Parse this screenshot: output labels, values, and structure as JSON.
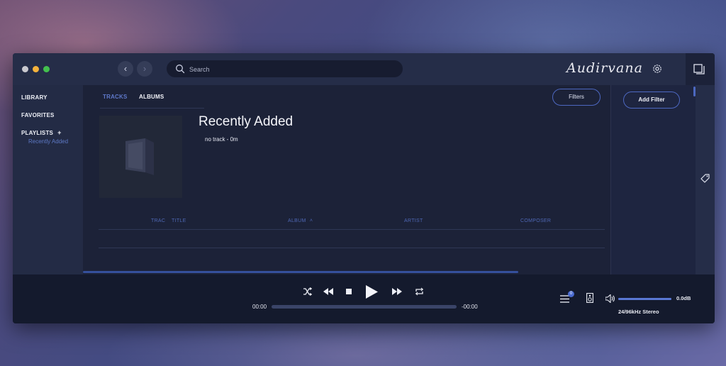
{
  "app": {
    "brand": "Audirvana",
    "search_placeholder": "Search"
  },
  "sidebar": {
    "library": "LIBRARY",
    "favorites": "FAVORITES",
    "playlists": "PLAYLISTS",
    "playlists_add": "+",
    "playlist_items": [
      "Recently Added"
    ]
  },
  "main": {
    "tabs": [
      "TRACKS",
      "ALBUMS"
    ],
    "active_tab": "TRACKS",
    "filters_label": "Filters",
    "playlist_title": "Recently Added",
    "playlist_meta": "no track - 0m",
    "columns": [
      "TRAC",
      "TITLE",
      "ALBUM",
      "ARTIST",
      "COMPOSER"
    ],
    "sort_column": "ALBUM"
  },
  "filter_panel": {
    "add_filter_label": "Add Filter"
  },
  "player": {
    "elapsed": "00:00",
    "remaining": "-00:00",
    "progress": 0,
    "queue_count": "0",
    "volume_db": "0.0dB",
    "volume_level": 1.0,
    "format": "24/96kHz Stereo"
  },
  "colors": {
    "accent": "#5e78c9",
    "window_bg": "#222a44",
    "player_bg": "#141a2d"
  },
  "icons": [
    "back-icon",
    "forward-icon",
    "search-icon",
    "settings-icon",
    "mini-player-icon",
    "album-placeholder-icon",
    "tag-icon",
    "shuffle-icon",
    "previous-icon",
    "stop-icon",
    "play-icon",
    "next-icon",
    "repeat-icon",
    "queue-icon",
    "speaker-device-icon",
    "volume-icon"
  ]
}
